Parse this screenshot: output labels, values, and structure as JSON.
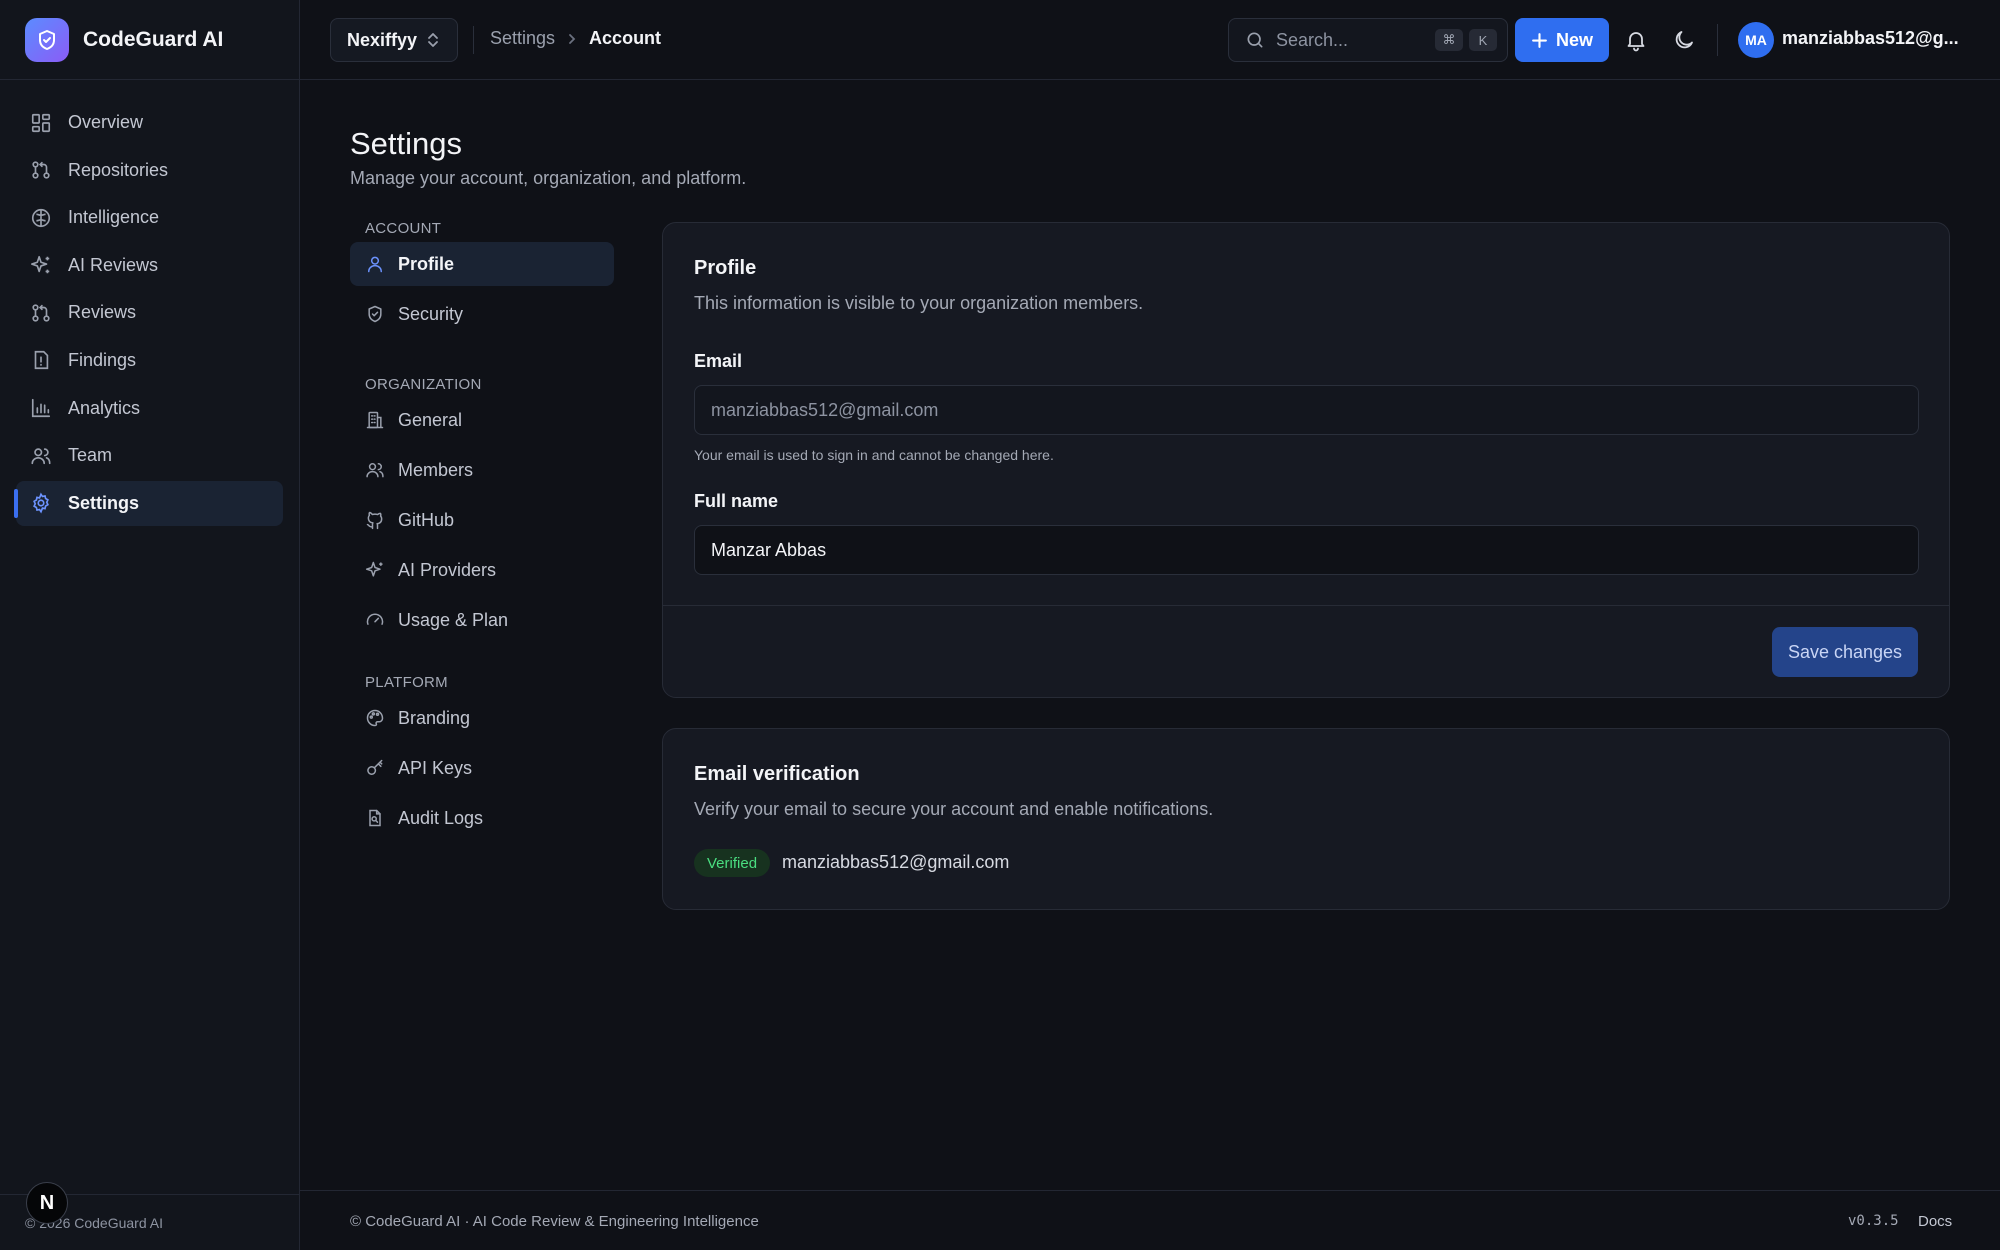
{
  "brand": {
    "name": "CodeGuard AI",
    "logo_icon": "shield-icon",
    "accent": "#2f6ef0"
  },
  "sidebar": {
    "items": [
      {
        "label": "Overview",
        "icon": "layout-dashboard-icon"
      },
      {
        "label": "Repositories",
        "icon": "git-pull-request-icon"
      },
      {
        "label": "Intelligence",
        "icon": "brain-icon"
      },
      {
        "label": "AI Reviews",
        "icon": "sparkles-icon"
      },
      {
        "label": "Reviews",
        "icon": "git-pull-request-icon"
      },
      {
        "label": "Findings",
        "icon": "alert-file-icon"
      },
      {
        "label": "Analytics",
        "icon": "bar-chart-icon"
      },
      {
        "label": "Team",
        "icon": "users-icon"
      },
      {
        "label": "Settings",
        "icon": "gear-icon",
        "active": true
      }
    ],
    "footer": "© 2026 CodeGuard AI",
    "n_badge": "N"
  },
  "topbar": {
    "org": "Nexiffyy",
    "breadcrumb": [
      "Settings",
      "Account"
    ],
    "search_placeholder": "Search...",
    "shortcut_keys": [
      "⌘",
      "K"
    ],
    "new_label": "New",
    "avatar_initials": "MA",
    "user_email": "manziabbas512@g..."
  },
  "page": {
    "title": "Settings",
    "subtitle": "Manage your account, organization, and platform."
  },
  "subnav": {
    "groups": [
      {
        "label": "ACCOUNT",
        "items": [
          {
            "label": "Profile",
            "icon": "user-icon",
            "active": true
          },
          {
            "label": "Security",
            "icon": "shield-check-icon"
          }
        ]
      },
      {
        "label": "ORGANIZATION",
        "items": [
          {
            "label": "General",
            "icon": "building-icon"
          },
          {
            "label": "Members",
            "icon": "users-icon"
          },
          {
            "label": "GitHub",
            "icon": "github-icon"
          },
          {
            "label": "AI Providers",
            "icon": "sparkles-icon"
          },
          {
            "label": "Usage & Plan",
            "icon": "gauge-icon"
          }
        ]
      },
      {
        "label": "PLATFORM",
        "items": [
          {
            "label": "Branding",
            "icon": "palette-icon"
          },
          {
            "label": "API Keys",
            "icon": "key-icon"
          },
          {
            "label": "Audit Logs",
            "icon": "file-search-icon"
          }
        ]
      }
    ]
  },
  "profile": {
    "title": "Profile",
    "description": "This information is visible to your organization members.",
    "email_label": "Email",
    "email_value": "manziabbas512@gmail.com",
    "email_hint": "Your email is used to sign in and cannot be changed here.",
    "name_label": "Full name",
    "name_value": "Manzar Abbas",
    "save_label": "Save changes"
  },
  "verification": {
    "title": "Email verification",
    "description": "Verify your email to secure your account and enable notifications.",
    "badge": "Verified",
    "badge_color": "#4ade80",
    "email": "manziabbas512@gmail.com"
  },
  "footer": {
    "left": "© CodeGuard AI · AI Code Review & Engineering Intelligence",
    "version": "v0.3.5",
    "docs": "Docs"
  }
}
